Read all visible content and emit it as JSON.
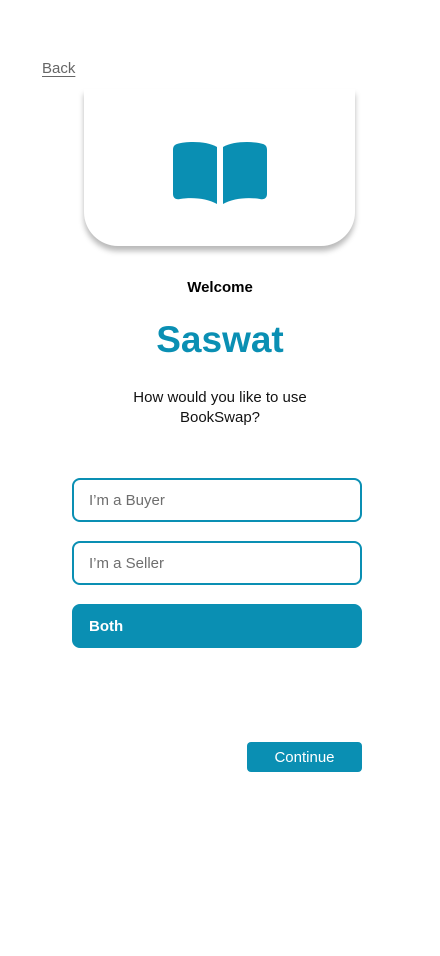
{
  "nav": {
    "back_label": "Back"
  },
  "logo": {
    "icon": "open-book-icon",
    "color": "#0A8FB3"
  },
  "greeting": {
    "welcome": "Welcome",
    "name": "Saswat",
    "question": "How would you like to use BookSwap?"
  },
  "options": [
    {
      "label": "I’m a Buyer",
      "selected": false
    },
    {
      "label": "I’m a Seller",
      "selected": false
    },
    {
      "label": "Both",
      "selected": true
    }
  ],
  "actions": {
    "continue_label": "Continue"
  },
  "colors": {
    "accent": "#0A8FB3",
    "muted_text": "#6e6e6e"
  }
}
